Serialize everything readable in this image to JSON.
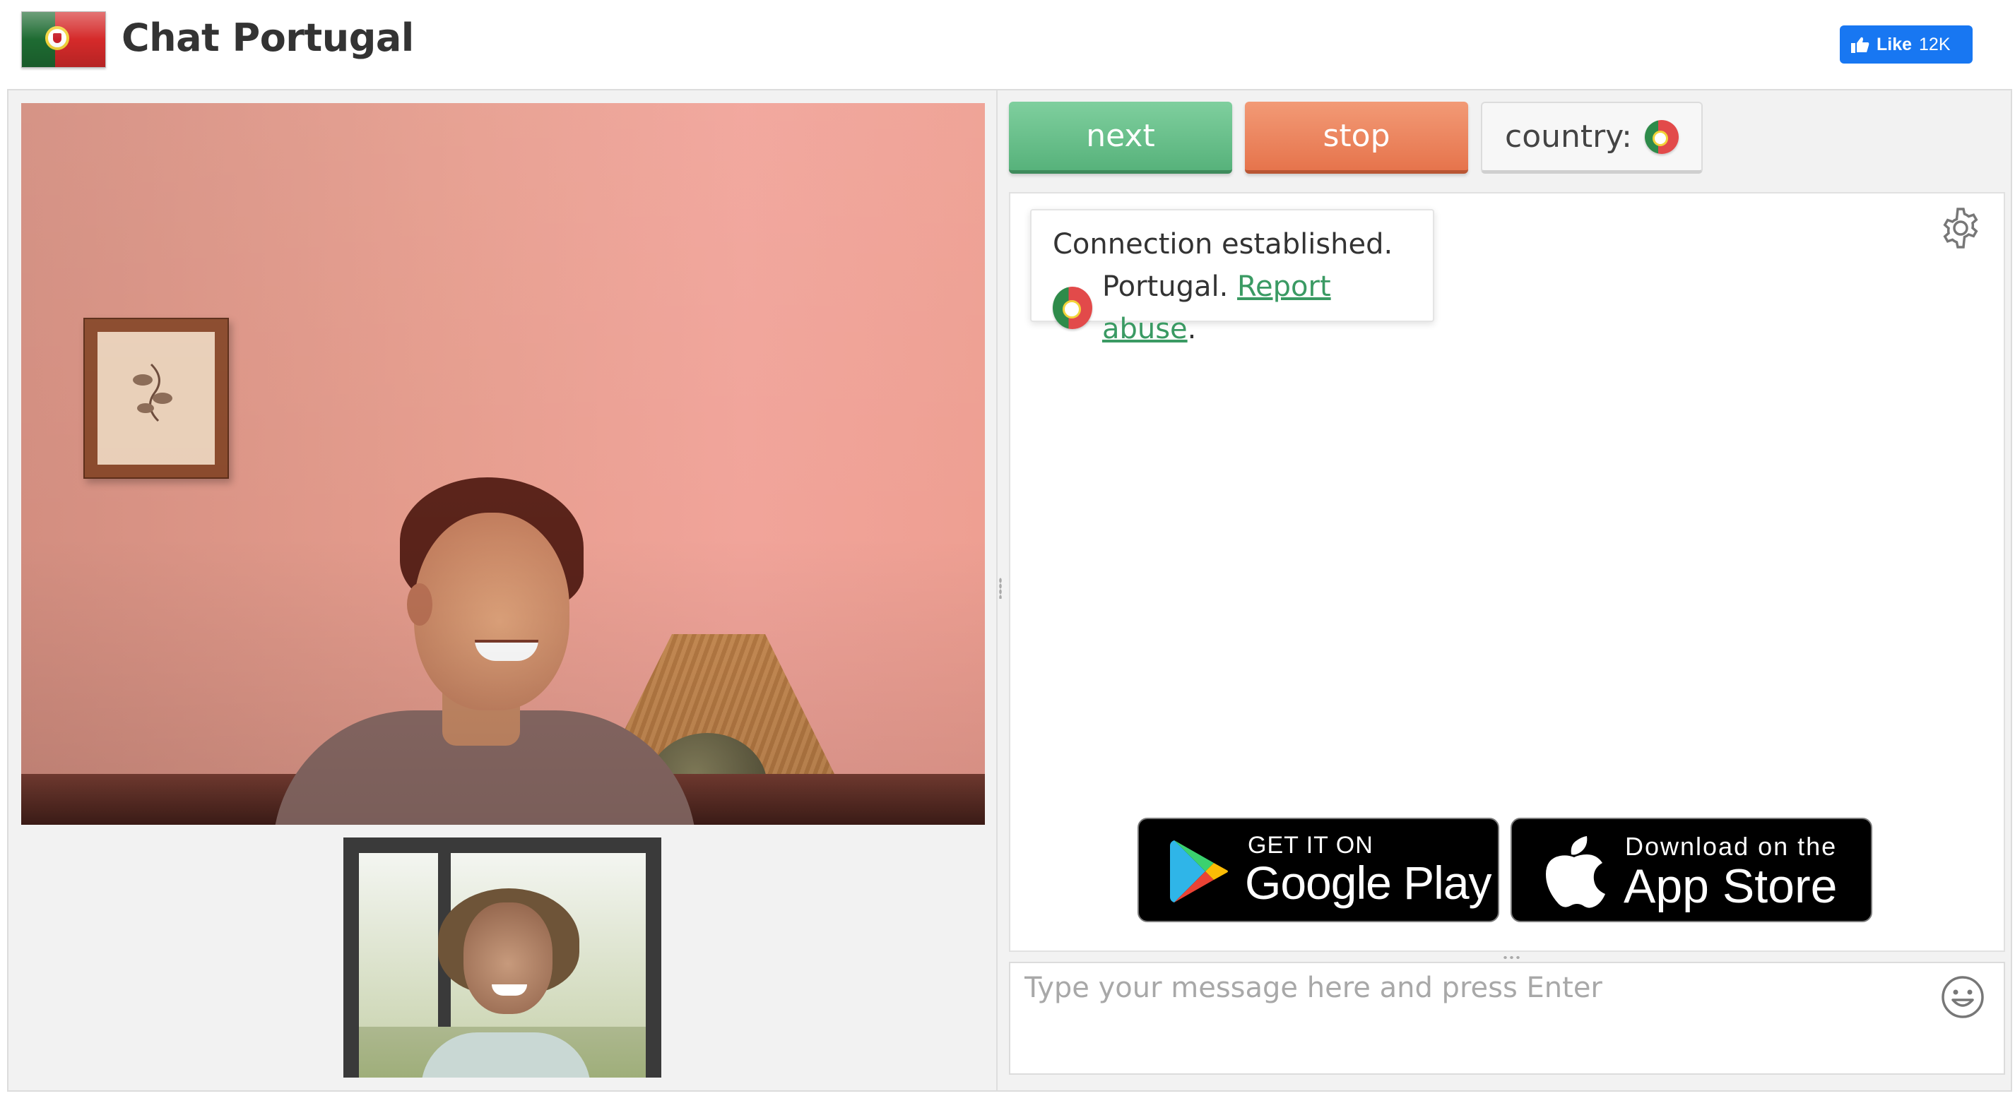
{
  "header": {
    "title": "Chat Portugal",
    "flag_icon": "portugal-flag-icon",
    "fb_like": {
      "label": "Like",
      "count": "12K",
      "color": "#1877f2"
    }
  },
  "controls": {
    "next_label": "next",
    "stop_label": "stop",
    "country_label": "country:",
    "next_color": "#5fb985",
    "stop_color": "#ea7d55"
  },
  "chat": {
    "status_message": "Connection established.",
    "country_name": "Portugal.",
    "report_link": "Report abuse",
    "report_suffix": ".",
    "settings_icon": "gear-icon"
  },
  "store_badges": {
    "google_small": "GET IT ON",
    "google_big": "Google Play",
    "apple_small": "Download on the",
    "apple_big": "App Store"
  },
  "message_input": {
    "placeholder": "Type your message here and press Enter",
    "value": "",
    "emoji_icon": "smiley-icon"
  }
}
